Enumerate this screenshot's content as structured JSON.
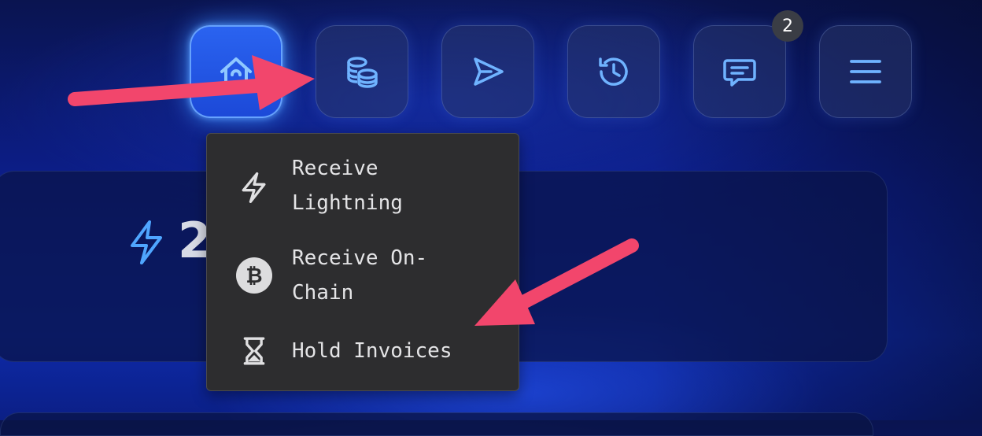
{
  "nav": {
    "buttons": [
      {
        "icon": "home-icon",
        "active": true
      },
      {
        "icon": "coins-icon",
        "active": false
      },
      {
        "icon": "send-icon",
        "active": false
      },
      {
        "icon": "history-icon",
        "active": false
      },
      {
        "icon": "chat-icon",
        "active": false,
        "badge": "2"
      },
      {
        "icon": "menu-icon",
        "active": false
      }
    ]
  },
  "balance": {
    "amount_visible": "2",
    "icon": "lightning-icon"
  },
  "receive_menu": {
    "items": [
      {
        "label": "Receive\nLightning",
        "icon": "lightning-icon"
      },
      {
        "label": "Receive On-\nChain",
        "icon": "bitcoin-icon"
      },
      {
        "label": "Hold Invoices",
        "icon": "hourglass-icon"
      }
    ]
  },
  "colors": {
    "accent": "#2a63f0",
    "icon_blue": "#6fb3ff",
    "annotation_arrow": "#f2466c",
    "menu_bg": "#2d2d2f"
  }
}
